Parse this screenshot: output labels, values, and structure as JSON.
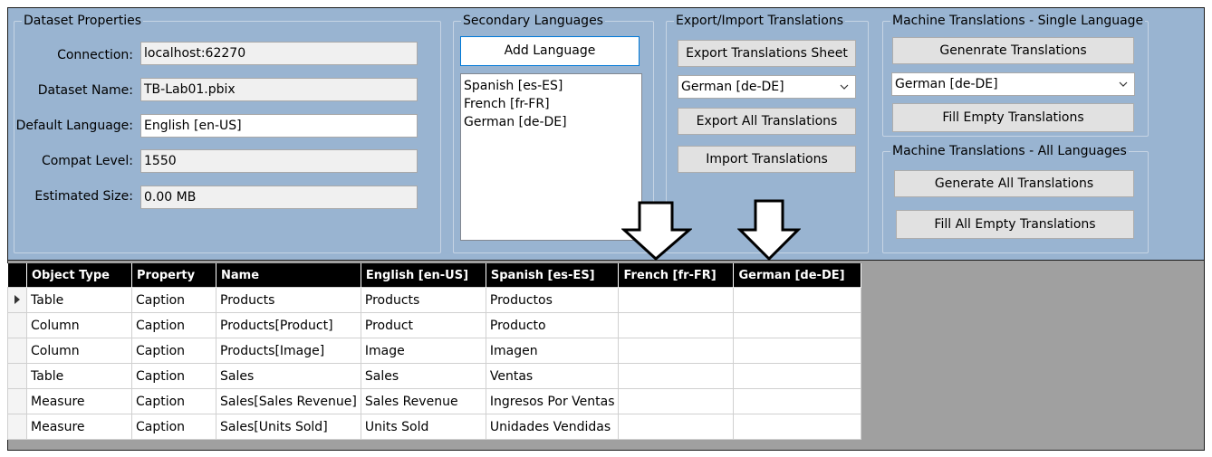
{
  "dataset_properties": {
    "title": "Dataset Properties",
    "connection_label": "Connection:",
    "connection_value": "localhost:62270",
    "dataset_name_label": "Dataset Name:",
    "dataset_name_value": "TB-Lab01.pbix",
    "default_language_label": "Default Language:",
    "default_language_value": "English [en-US]",
    "compat_level_label": "Compat Level:",
    "compat_level_value": "1550",
    "estimated_size_label": "Estimated Size:",
    "estimated_size_value": "0.00 MB"
  },
  "secondary_languages": {
    "title": "Secondary Languages",
    "add_language_label": "Add Language",
    "items": [
      "Spanish [es-ES]",
      "French [fr-FR]",
      "German [de-DE]"
    ]
  },
  "export_import": {
    "title": "Export/Import Translations",
    "export_sheet_label": "Export Translations Sheet",
    "language_select_value": "German [de-DE]",
    "export_all_label": "Export All Translations",
    "import_label": "Import Translations"
  },
  "machine_single": {
    "title": "Machine Translations - Single Language",
    "generate_label": "Genenrate Translations",
    "language_select_value": "German [de-DE]",
    "fill_empty_label": "Fill Empty Translations"
  },
  "machine_all": {
    "title": "Machine Translations - All Languages",
    "generate_all_label": "Generate All Translations",
    "fill_all_empty_label": "Fill All Empty Translations"
  },
  "grid": {
    "columns": [
      "Object Type",
      "Property",
      "Name",
      "English [en-US]",
      "Spanish [es-ES]",
      "French [fr-FR]",
      "German [de-DE]"
    ],
    "rows": [
      [
        "Table",
        "Caption",
        "Products",
        "Products",
        "Productos",
        "",
        ""
      ],
      [
        "Column",
        "Caption",
        "Products[Product]",
        "Product",
        "Producto",
        "",
        ""
      ],
      [
        "Column",
        "Caption",
        "Products[Image]",
        "Image",
        "Imagen",
        "",
        ""
      ],
      [
        "Table",
        "Caption",
        "Sales",
        "Sales",
        "Ventas",
        "",
        ""
      ],
      [
        "Measure",
        "Caption",
        "Sales[Sales Revenue]",
        "Sales Revenue",
        "Ingresos Por Ventas",
        "",
        ""
      ],
      [
        "Measure",
        "Caption",
        "Sales[Units Sold]",
        "Units Sold",
        "Unidades Vendidas",
        "",
        ""
      ]
    ]
  }
}
